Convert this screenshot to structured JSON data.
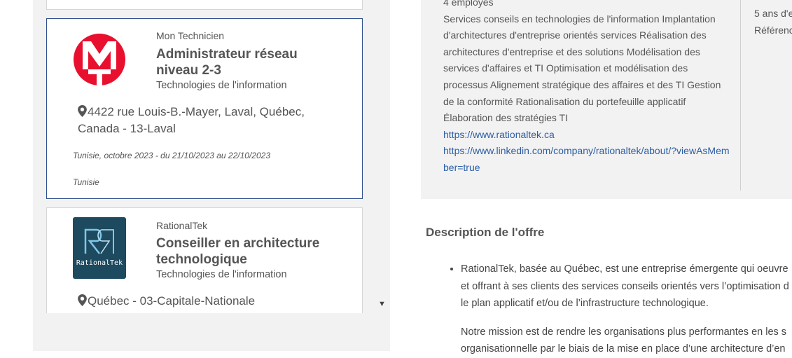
{
  "list": {
    "cards": [
      {
        "company": "Mon Technicien",
        "title": "Administrateur réseau niveau 2-3",
        "sector": "Technologies de l'information",
        "location": "4422 rue Louis-B.-Mayer, Laval, Québec, Canada - 13-Laval",
        "period": "Tunisie, octobre 2023 - du 21/10/2023 au 22/10/2023",
        "country": "Tunisie",
        "logo_color": "#e8102e"
      },
      {
        "company": "RationalTek",
        "title": "Conseiller en architecture technologique",
        "sector": "Technologies de l'information",
        "location": "Québec - 03-Capitale-Nationale",
        "logo_text": "RationalTek",
        "logo_color": "#1e4a5f"
      }
    ]
  },
  "detail": {
    "employees": "4 employés",
    "services": "Services conseils en technologies de l'information Implantation d'architectures d'entreprise orientés services Réalisation des architectures d'entreprise et des solutions Modélisation des services d'affaires et TI Optimisation et modélisation des processus Alignement stratégique des affaires et des TI Gestion de la conformité Rationalisation du portefeuille applicatif Élaboration des stratégies TI",
    "website": "https://www.rationaltek.ca",
    "linkedin": "https://www.linkedin.com/company/rationaltek/about/?viewAsMember=true",
    "side_line1": "5 ans d'e",
    "side_line2": "Référenc"
  },
  "description": {
    "heading": "Description de l'offre",
    "bullet": "RationalTek, basée au Québec, est une entreprise émergente qui oeuvre\net offrant à ses clients des services conseils orientés vers l’optimisation d\nle plan applicatif et/ou de l’infrastructure technologique.",
    "mission": "Notre mission est de rendre les organisations plus performantes en les s",
    "mission_cut": "organisationnelle par le biais de la mise en place d’une architecture d’en"
  }
}
